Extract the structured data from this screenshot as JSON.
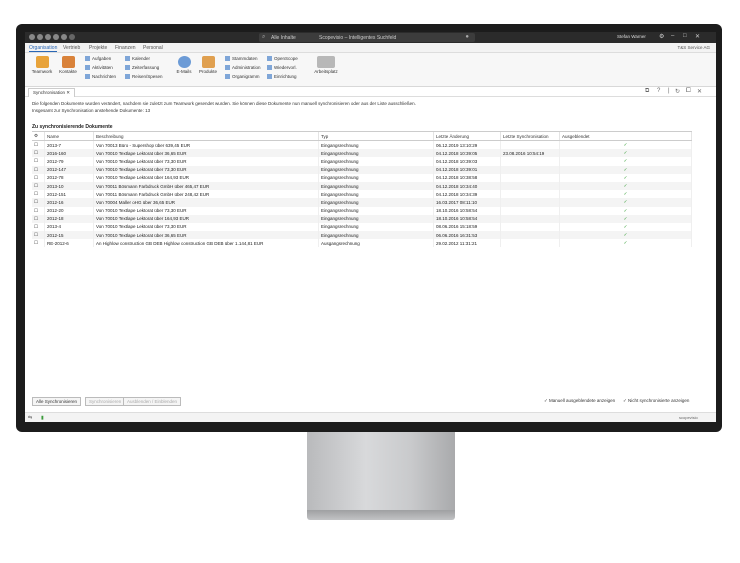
{
  "search": {
    "scope": "Alle Inhalte",
    "text": "Scopevisio – Intelligentes Suchfeld"
  },
  "user": {
    "name": "Stefan Warner"
  },
  "menu": {
    "items": [
      "Organisation",
      "Vertrieb",
      "Projekte",
      "Finanzen",
      "Personal"
    ],
    "company": "T&S Service AG"
  },
  "ribbon": {
    "teamwork": "Teamwork",
    "kontakte": "Kontakte",
    "aufgaben": "Aufgaben",
    "aktivitaeten": "Aktivitäten",
    "nachrichten": "Nachrichten",
    "kalender": "Kalender",
    "zeiterfassung": "Zeiterfassung",
    "reisen": "Reisen/Spesen",
    "emails": "E-Mails",
    "produkte": "Produkte",
    "stammdaten": "Stammdaten",
    "administration": "Administration",
    "organigramm": "Organigramm",
    "openscope": "OpenScope",
    "wiedervorlage": "Wiedervorl.",
    "einrichtung": "Einrichtung",
    "arbeitsplatz": "Arbeitsplatz"
  },
  "tab": {
    "label": "Synchronisation"
  },
  "info": {
    "line1": "Die folgenden Dokumente wurden verändert, nachdem sie zuletzt zum Teamwork gesendet wurden. Sie können diese Dokumente nun manuell synchronisieren oder aus der Liste ausschließen.",
    "line2": "Insgesamt zur Synchronisation anstehende Dokumente: 13"
  },
  "section": {
    "title": "Zu synchronisierende Dokumente"
  },
  "table": {
    "headers": [
      "Name",
      "Beschreibung",
      "Typ",
      "Letzte Änderung",
      "Letzte Synchronisation",
      "Ausgeblendet"
    ],
    "rows": [
      {
        "name": "2013-7",
        "desc": "Von 70013 Büro - Supershop über 639,45 EUR",
        "typ": "Eingangsrechnung",
        "last": "06.12.2019 13:10:29",
        "sync": "",
        "hidden": "✓"
      },
      {
        "name": "2016-160",
        "desc": "Von 70010 Textlape Lektorat über 36,65 EUR",
        "typ": "Eingangsrechnung",
        "last": "04.12.2018 10:39:05",
        "sync": "23.08.2016 10:54:19",
        "hidden": "✓"
      },
      {
        "name": "2012-79",
        "desc": "Von 70010 Textlape Lektorat über 73,30 EUR",
        "typ": "Eingangsrechnung",
        "last": "04.12.2018 10:39:03",
        "sync": "",
        "hidden": "✓"
      },
      {
        "name": "2012-147",
        "desc": "Von 70010 Textlape Lektorat über 73,30 EUR",
        "typ": "Eingangsrechnung",
        "last": "04.12.2018 10:39:01",
        "sync": "",
        "hidden": "✓"
      },
      {
        "name": "2012-78",
        "desc": "Von 70010 Textlape Lektorat über 164,93 EUR",
        "typ": "Eingangsrechnung",
        "last": "04.12.2018 10:38:58",
        "sync": "",
        "hidden": "✓"
      },
      {
        "name": "2013-10",
        "desc": "Von 70011 Bösmann Farbdruck GmbH über 465,47 EUR",
        "typ": "Eingangsrechnung",
        "last": "04.12.2018 10:34:40",
        "sync": "",
        "hidden": "✓"
      },
      {
        "name": "2012-151",
        "desc": "Von 70011 Bösmann Farbdruck GmbH über 248,42 EUR",
        "typ": "Eingangsrechnung",
        "last": "04.12.2018 10:34:39",
        "sync": "",
        "hidden": "✓"
      },
      {
        "name": "2012-16",
        "desc": "Von 70004 Maller oHG über 36,65 EUR",
        "typ": "Eingangsrechnung",
        "last": "16.03.2017 08:11:10",
        "sync": "",
        "hidden": "✓"
      },
      {
        "name": "2012-20",
        "desc": "Von 70010 Textlape Lektorat über 73,30 EUR",
        "typ": "Eingangsrechnung",
        "last": "18.10.2016 10:58:54",
        "sync": "",
        "hidden": "✓"
      },
      {
        "name": "2012-18",
        "desc": "Von 70010 Textlape Lektorat über 164,93 EUR",
        "typ": "Eingangsrechnung",
        "last": "18.10.2016 10:58:54",
        "sync": "",
        "hidden": "✓"
      },
      {
        "name": "2013-4",
        "desc": "Von 70010 Textlape Lektorat über 73,30 EUR",
        "typ": "Eingangsrechnung",
        "last": "08.06.2016 15:18:59",
        "sync": "",
        "hidden": "✓"
      },
      {
        "name": "2012-15",
        "desc": "Von 70010 Textlape Lektorat über 36,65 EUR",
        "typ": "Eingangsrechnung",
        "last": "06.06.2016 16:31:53",
        "sync": "",
        "hidden": "✓"
      },
      {
        "name": "RE-2012-6",
        "desc": "An Highlow construction GB DEB Highlow construction GB DEB über 1.144,81 EUR",
        "typ": "Ausgangsrechnung",
        "last": "29.02.2012 11:31:21",
        "sync": "",
        "hidden": "✓"
      }
    ]
  },
  "buttons": {
    "sync_all": "Alle Synchronisieren",
    "sync": "Synchronisieren",
    "hide": "Ausblenden / Einblenden"
  },
  "options": {
    "show_hidden": "Manuell ausgeblendete anzeigen",
    "not_synced": "Nicht synchronisierte anzeigen"
  },
  "status": {
    "text": "scopevisio"
  }
}
